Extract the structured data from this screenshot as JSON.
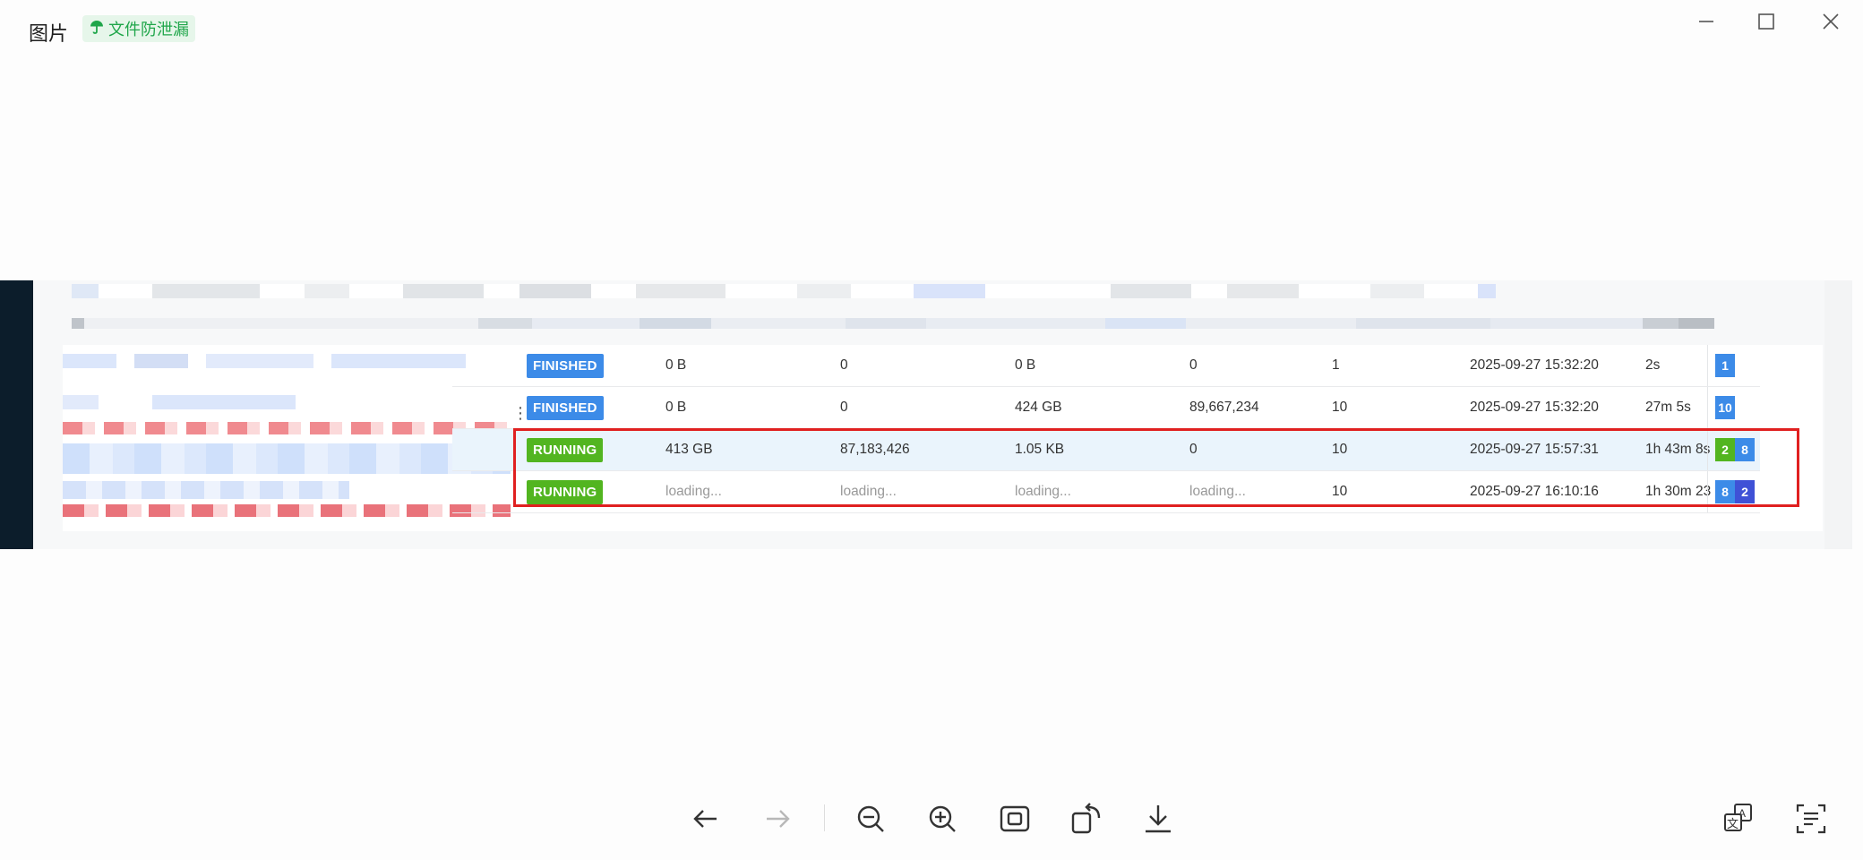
{
  "window": {
    "title": "图片",
    "dlp_tag": "文件防泄漏",
    "controls": [
      "minimize-icon",
      "maximize-icon",
      "close-icon"
    ]
  },
  "table": {
    "rows": [
      {
        "status": "FINISHED",
        "c1": "0 B",
        "c2": "0",
        "c3": "0 B",
        "c4": "0",
        "c5": "1",
        "started": "2025-09-27 15:32:20",
        "duration": "2s",
        "counts": [
          "1"
        ]
      },
      {
        "status": "FINISHED",
        "c1": "0 B",
        "c2": "0",
        "c3": "424 GB",
        "c4": "89,667,234",
        "c5": "10",
        "started": "2025-09-27 15:32:20",
        "duration": "27m 5s",
        "counts": [
          "10"
        ]
      },
      {
        "status": "RUNNING",
        "c1": "413 GB",
        "c2": "87,183,426",
        "c3": "1.05 KB",
        "c4": "0",
        "c5": "10",
        "started": "2025-09-27 15:57:31",
        "duration": "1h 43m 8s",
        "counts": [
          "2",
          "8"
        ]
      },
      {
        "status": "RUNNING",
        "c1": "loading...",
        "c2": "loading...",
        "c3": "loading...",
        "c4": "loading...",
        "c5": "10",
        "started": "2025-09-27 16:10:16",
        "duration": "1h 30m 23",
        "counts": [
          "8",
          "2"
        ]
      }
    ]
  },
  "toolbar": {
    "items": [
      "arrow-left-icon",
      "arrow-right-icon",
      "zoom-out-icon",
      "zoom-in-icon",
      "fit-screen-icon",
      "rotate-icon",
      "download-icon",
      "translate-icon",
      "ocr-text-icon"
    ]
  },
  "colors": {
    "finished": "#3c8be8",
    "running": "#52b520",
    "highlight_border": "#e02020",
    "dlp_green": "#1fa64a"
  }
}
